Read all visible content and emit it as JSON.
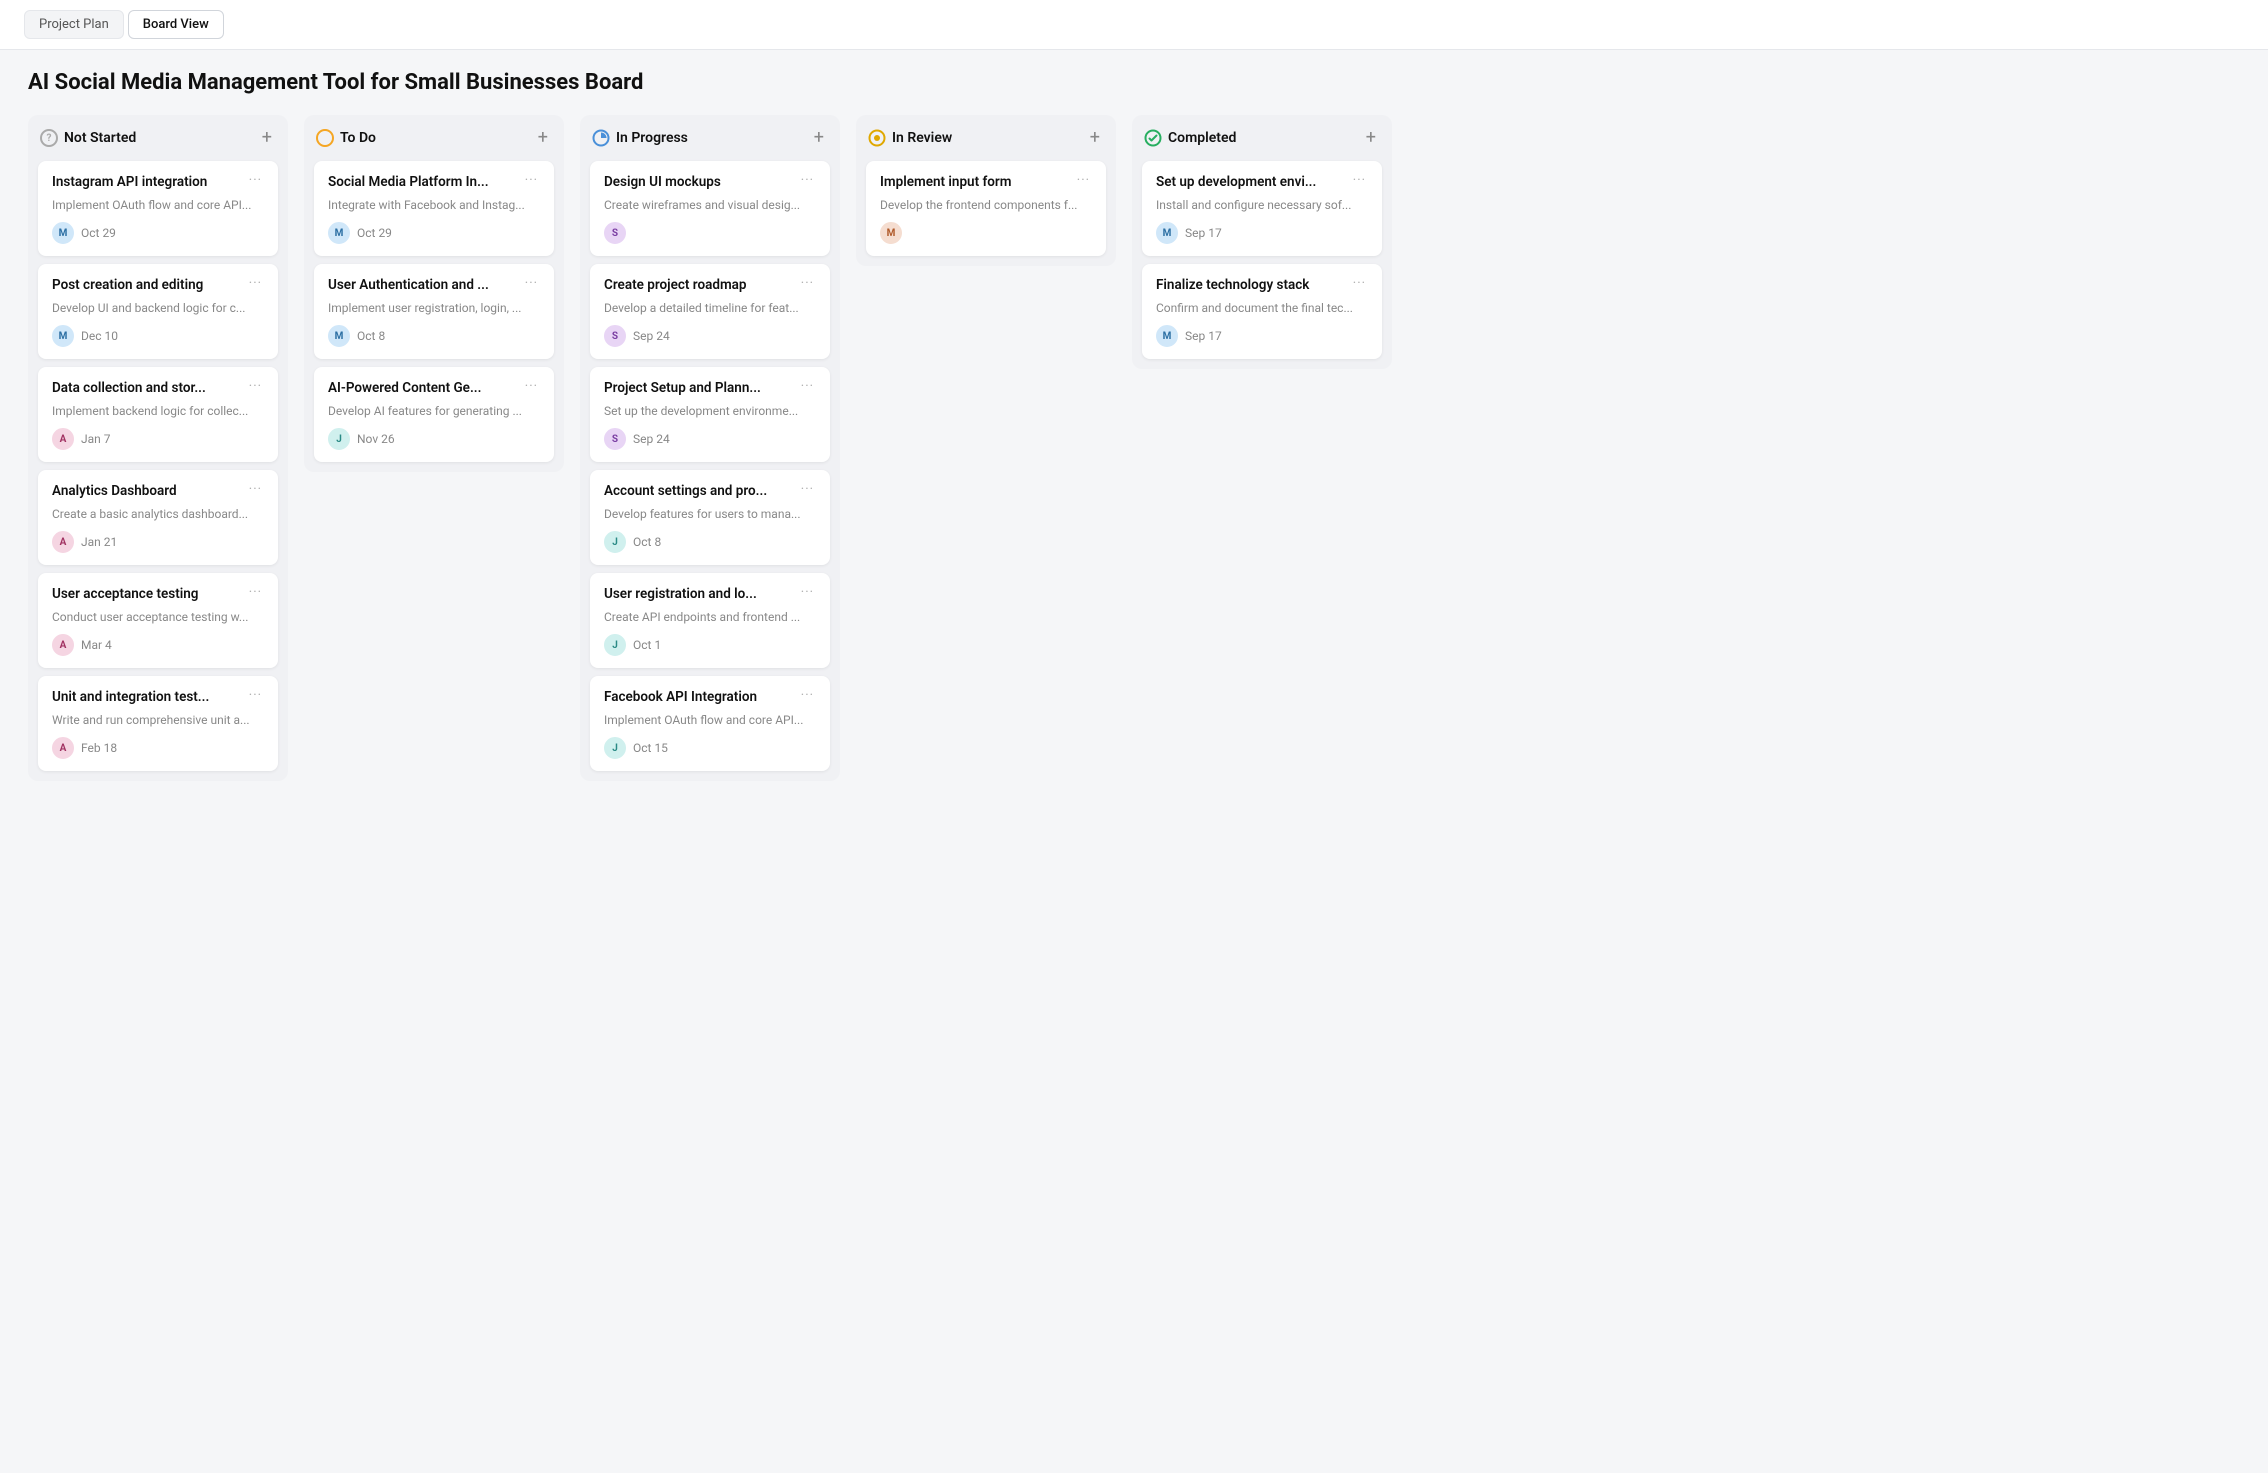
{
  "tabs": [
    {
      "id": "project-plan",
      "label": "Project Plan",
      "active": false
    },
    {
      "id": "board-view",
      "label": "Board View",
      "active": true
    }
  ],
  "boardTitle": "AI Social Media Management Tool for Small Businesses Board",
  "columns": [
    {
      "id": "not-started",
      "title": "Not Started",
      "icon": "?",
      "iconColor": "#888",
      "cards": [
        {
          "id": "card-1",
          "title": "Instagram API integration",
          "desc": "Implement OAuth flow and core API...",
          "avatar": "M",
          "avatarColor": "av-blue",
          "date": "Oct 29"
        },
        {
          "id": "card-2",
          "title": "Post creation and editing",
          "desc": "Develop UI and backend logic for c...",
          "avatar": "M",
          "avatarColor": "av-blue",
          "date": "Dec 10"
        },
        {
          "id": "card-3",
          "title": "Data collection and stor...",
          "desc": "Implement backend logic for collec...",
          "avatar": "A",
          "avatarColor": "av-pink",
          "date": "Jan 7"
        },
        {
          "id": "card-4",
          "title": "Analytics Dashboard",
          "desc": "Create a basic analytics dashboard...",
          "avatar": "A",
          "avatarColor": "av-pink",
          "date": "Jan 21"
        },
        {
          "id": "card-5",
          "title": "User acceptance testing",
          "desc": "Conduct user acceptance testing w...",
          "avatar": "A",
          "avatarColor": "av-pink",
          "date": "Mar 4"
        },
        {
          "id": "card-6",
          "title": "Unit and integration test...",
          "desc": "Write and run comprehensive unit a...",
          "avatar": "A",
          "avatarColor": "av-pink",
          "date": "Feb 18"
        }
      ]
    },
    {
      "id": "to-do",
      "title": "To Do",
      "icon": "○",
      "iconColor": "#f5a623",
      "cards": [
        {
          "id": "card-7",
          "title": "Social Media Platform In...",
          "desc": "Integrate with Facebook and Instag...",
          "avatar": "M",
          "avatarColor": "av-blue",
          "date": "Oct 29"
        },
        {
          "id": "card-8",
          "title": "User Authentication and ...",
          "desc": "Implement user registration, login, ...",
          "avatar": "M",
          "avatarColor": "av-blue",
          "date": "Oct 8"
        },
        {
          "id": "card-9",
          "title": "AI-Powered Content Ge...",
          "desc": "Develop AI features for generating ...",
          "avatar": "J",
          "avatarColor": "av-teal",
          "date": "Nov 26"
        }
      ]
    },
    {
      "id": "in-progress",
      "title": "In Progress",
      "icon": "◷",
      "iconColor": "#4a90d9",
      "cards": [
        {
          "id": "card-10",
          "title": "Design UI mockups",
          "desc": "Create wireframes and visual desig...",
          "avatar": "S",
          "avatarColor": "av-purple",
          "date": ""
        },
        {
          "id": "card-11",
          "title": "Create project roadmap",
          "desc": "Develop a detailed timeline for feat...",
          "avatar": "S",
          "avatarColor": "av-purple",
          "date": "Sep 24"
        },
        {
          "id": "card-12",
          "title": "Project Setup and Plann...",
          "desc": "Set up the development environme...",
          "avatar": "S",
          "avatarColor": "av-purple",
          "date": "Sep 24"
        },
        {
          "id": "card-13",
          "title": "Account settings and pro...",
          "desc": "Develop features for users to mana...",
          "avatar": "J",
          "avatarColor": "av-teal",
          "date": "Oct 8"
        },
        {
          "id": "card-14",
          "title": "User registration and lo...",
          "desc": "Create API endpoints and frontend ...",
          "avatar": "J",
          "avatarColor": "av-teal",
          "date": "Oct 1"
        },
        {
          "id": "card-15",
          "title": "Facebook API Integration",
          "desc": "Implement OAuth flow and core API...",
          "avatar": "J",
          "avatarColor": "av-teal",
          "date": "Oct 15"
        }
      ]
    },
    {
      "id": "in-review",
      "title": "In Review",
      "icon": "⊙",
      "iconColor": "#e0a800",
      "cards": [
        {
          "id": "card-16",
          "title": "Implement input form",
          "desc": "Develop the frontend components f...",
          "avatar": "M",
          "avatarColor": "av-orange",
          "date": ""
        }
      ]
    },
    {
      "id": "completed",
      "title": "Completed",
      "icon": "✓",
      "iconColor": "#27ae60",
      "cards": [
        {
          "id": "card-17",
          "title": "Set up development envi...",
          "desc": "Install and configure necessary sof...",
          "avatar": "M",
          "avatarColor": "av-blue",
          "date": "Sep 17"
        },
        {
          "id": "card-18",
          "title": "Finalize technology stack",
          "desc": "Confirm and document the final tec...",
          "avatar": "M",
          "avatarColor": "av-blue",
          "date": "Sep 17"
        }
      ]
    }
  ],
  "labels": {
    "add": "+",
    "menu": "···"
  }
}
